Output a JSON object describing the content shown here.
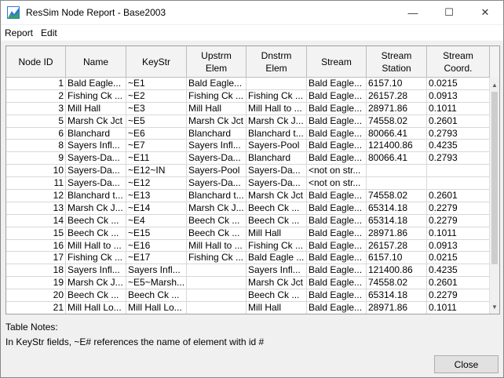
{
  "window": {
    "title": "ResSim Node Report - Base2003",
    "minimize_glyph": "—",
    "maximize_glyph": "☐",
    "close_glyph": "✕"
  },
  "menu": [
    "Report",
    "Edit"
  ],
  "table": {
    "columns": [
      "Node ID",
      "Name",
      "KeyStr",
      "Upstrm\nElem",
      "Dnstrm\nElem",
      "Stream",
      "Stream\nStation",
      "Stream\nCoord."
    ],
    "rows": [
      [
        "1",
        "Bald Eagle...",
        "~E1",
        "Bald Eagle...",
        "",
        "Bald Eagle...",
        "6157.10",
        "0.0215"
      ],
      [
        "2",
        "Fishing Ck ...",
        "~E2",
        "Fishing Ck ...",
        "Fishing Ck ...",
        "Bald Eagle...",
        "26157.28",
        "0.0913"
      ],
      [
        "3",
        "Mill Hall",
        "~E3",
        "Mill Hall",
        "Mill Hall to ...",
        "Bald Eagle...",
        "28971.86",
        "0.1011"
      ],
      [
        "5",
        "Marsh Ck Jct",
        "~E5",
        "Marsh Ck Jct",
        "Marsh Ck J...",
        "Bald Eagle...",
        "74558.02",
        "0.2601"
      ],
      [
        "6",
        "Blanchard",
        "~E6",
        "Blanchard",
        "Blanchard t...",
        "Bald Eagle...",
        "80066.41",
        "0.2793"
      ],
      [
        "8",
        "Sayers Infl...",
        "~E7",
        "Sayers Infl...",
        "Sayers-Pool",
        "Bald Eagle...",
        "121400.86",
        "0.4235"
      ],
      [
        "9",
        "Sayers-Da...",
        "~E11",
        "Sayers-Da...",
        "Blanchard",
        "Bald Eagle...",
        "80066.41",
        "0.2793"
      ],
      [
        "10",
        "Sayers-Da...",
        "~E12~IN",
        "Sayers-Pool",
        "Sayers-Da...",
        "<not on str...",
        "",
        ""
      ],
      [
        "11",
        "Sayers-Da...",
        "~E12",
        "Sayers-Da...",
        "Sayers-Da...",
        "<not on str...",
        "",
        ""
      ],
      [
        "12",
        "Blanchard t...",
        "~E13",
        "Blanchard t...",
        "Marsh Ck Jct",
        "Bald Eagle...",
        "74558.02",
        "0.2601"
      ],
      [
        "13",
        "Marsh Ck J...",
        "~E14",
        "Marsh Ck J...",
        "Beech Ck ...",
        "Bald Eagle...",
        "65314.18",
        "0.2279"
      ],
      [
        "14",
        "Beech Ck ...",
        "~E4",
        "Beech Ck ...",
        "Beech Ck ...",
        "Bald Eagle...",
        "65314.18",
        "0.2279"
      ],
      [
        "15",
        "Beech Ck ...",
        "~E15",
        "Beech Ck ...",
        "Mill Hall",
        "Bald Eagle...",
        "28971.86",
        "0.1011"
      ],
      [
        "16",
        "Mill Hall to ...",
        "~E16",
        "Mill Hall to ...",
        "Fishing Ck ...",
        "Bald Eagle...",
        "26157.28",
        "0.0913"
      ],
      [
        "17",
        "Fishing Ck ...",
        "~E17",
        "Fishing Ck ...",
        "Bald Eagle ...",
        "Bald Eagle...",
        "6157.10",
        "0.0215"
      ],
      [
        "18",
        "Sayers Infl...",
        "Sayers Infl...",
        "",
        "Sayers Infl...",
        "Bald Eagle...",
        "121400.86",
        "0.4235"
      ],
      [
        "19",
        "Marsh Ck J...",
        "~E5~Marsh...",
        "",
        "Marsh Ck Jct",
        "Bald Eagle...",
        "74558.02",
        "0.2601"
      ],
      [
        "20",
        "Beech Ck ...",
        "Beech Ck ...",
        "",
        "Beech Ck ...",
        "Bald Eagle...",
        "65314.18",
        "0.2279"
      ],
      [
        "21",
        "Mill Hall Lo...",
        "Mill Hall Lo...",
        "",
        "Mill Hall",
        "Bald Eagle...",
        "28971.86",
        "0.1011"
      ]
    ]
  },
  "notes": {
    "title": "Table Notes:",
    "text": "In KeyStr fields, ~E# references the name of element with id #"
  },
  "buttons": {
    "close": "Close"
  },
  "scrollbar": {
    "up_glyph": "▲",
    "down_glyph": "▼"
  },
  "colors": {
    "accent_icon": "#2f7bd0",
    "icon_green": "#3aa35a"
  }
}
